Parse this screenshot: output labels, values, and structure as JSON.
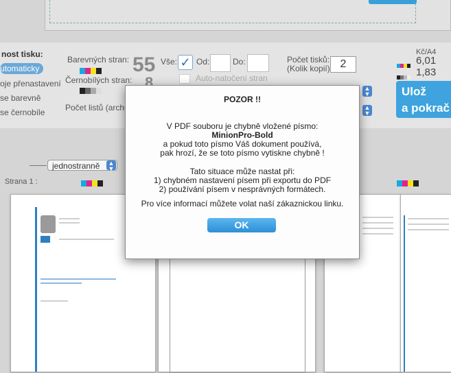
{
  "settings": {
    "quality_title": "nost tisku:",
    "quality_options": [
      "utomaticky",
      "oje přenastavení",
      "se barevně",
      "se černobíle"
    ],
    "color_pages_label": "Barevných stran:",
    "color_pages_count": "55",
    "bw_pages_label": "Černobílých stran:",
    "bw_pages_count": "8",
    "sheets_label": "Počet listů (archů)",
    "all_label": "Vše:",
    "from_label": "Od:",
    "to_label": "Do:",
    "auto_rotate_label": "Auto-natočení stran",
    "copies_label": "Počet tisků:",
    "copies_sublabel": "(Kolik kopií)",
    "copies_value": "2",
    "price_unit": "Kč/A4",
    "price_color": "6,01",
    "price_bw": "1,83",
    "save_button": "Ulož\na pokrač"
  },
  "preview": {
    "side_select": "jednostranně",
    "page_label": "Strana 1 :"
  },
  "modal": {
    "title": "POZOR !!",
    "line1": "V PDF souboru je chybně vložené písmo:",
    "font_name": "MinionPro-Bold",
    "line2": "a pokud toto písmo Váš dokument používá,",
    "line3": "pak hrozí, že se toto písmo vytiskne chybně !",
    "line4": "Tato situace může nastat při:",
    "line5": "1) chybném nastavení písem při exportu do PDF",
    "line6": "2) používání písem v nesprávných formátech.",
    "line7": "Pro více informací můžete volat naší zákaznickou linku.",
    "ok_label": "OK"
  },
  "colors": {
    "accent": "#3ea3de",
    "cmyk": [
      "#1ba7df",
      "#e0248c",
      "#f5e21a",
      "#222222"
    ]
  }
}
